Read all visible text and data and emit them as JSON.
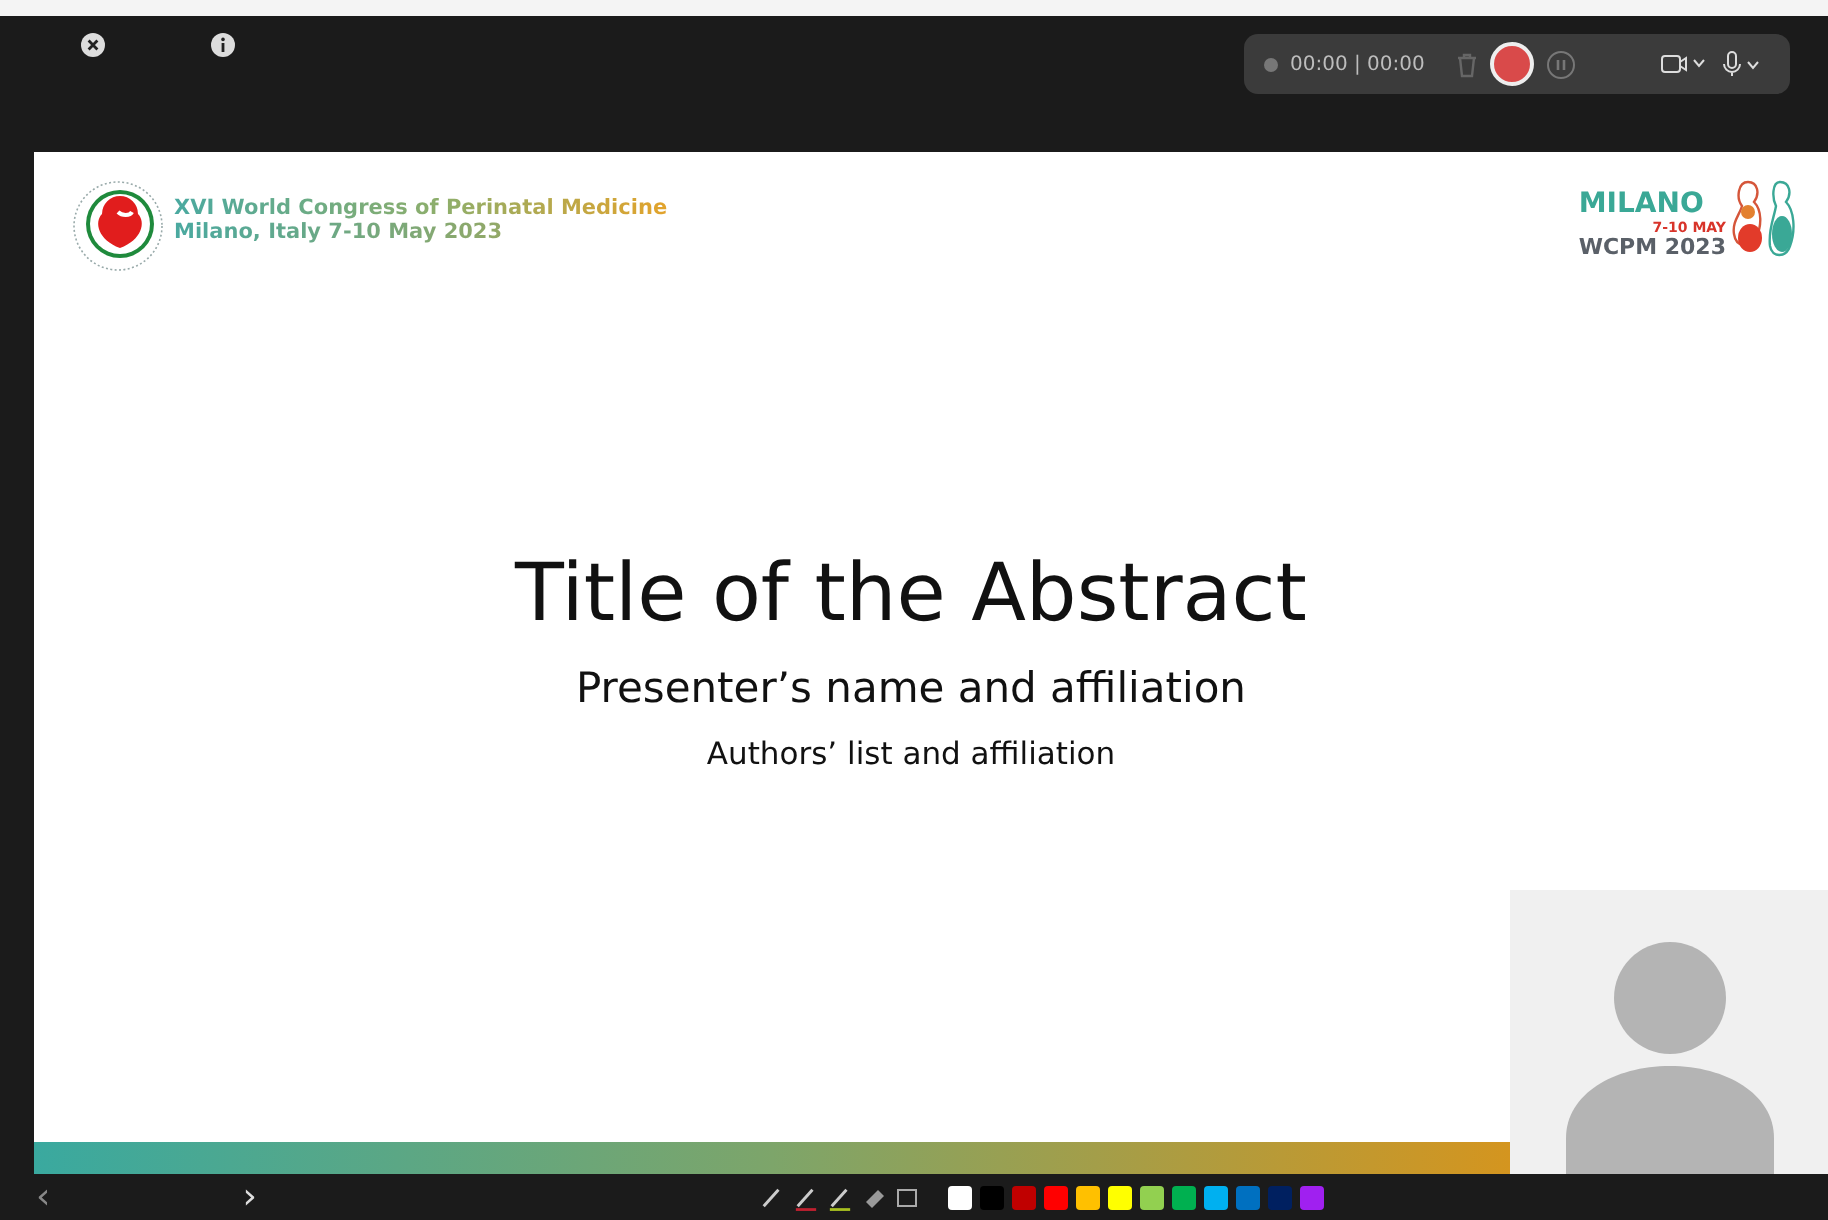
{
  "recorder": {
    "time": "00:00 | 00:00"
  },
  "slide": {
    "header": {
      "congress": "XVI World Congress of Perinatal Medicine",
      "place": "Milano, Italy 7-10 May 2023"
    },
    "event_logo": {
      "city": "MILANO",
      "dates": "7-10 MAY",
      "name": "WCPM 2023"
    },
    "title": "Title of the Abstract",
    "presenter": "Presenter’s name and affiliation",
    "authors": "Authors’ list and affiliation"
  },
  "navigation": {
    "previous": "‹",
    "next": "›"
  },
  "palette": [
    {
      "color": "#ffffff"
    },
    {
      "color": "#000000"
    },
    {
      "color": "#c00000"
    },
    {
      "color": "#ff0000"
    },
    {
      "color": "#ffc000"
    },
    {
      "color": "#ffff00"
    },
    {
      "color": "#92d050"
    },
    {
      "color": "#00b050"
    },
    {
      "color": "#00b0f0"
    },
    {
      "color": "#0070c0"
    },
    {
      "color": "#002060"
    },
    {
      "color": "#a020f0"
    }
  ]
}
